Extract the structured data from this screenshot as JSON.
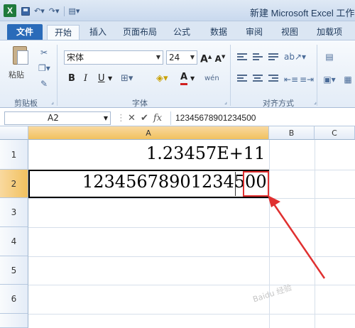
{
  "window": {
    "title": "新建 Microsoft Excel 工作表",
    "app_icon": "X"
  },
  "ribbon_tabs": [
    {
      "label": "文件"
    },
    {
      "label": "开始"
    },
    {
      "label": "插入"
    },
    {
      "label": "页面布局"
    },
    {
      "label": "公式"
    },
    {
      "label": "数据"
    },
    {
      "label": "审阅"
    },
    {
      "label": "视图"
    },
    {
      "label": "加载项"
    }
  ],
  "clipboard": {
    "paste_label": "粘贴",
    "group_label": "剪贴板"
  },
  "font": {
    "name": "宋体",
    "size": "24",
    "grow_glyph": "A",
    "shrink_glyph": "A",
    "bold": "B",
    "italic": "I",
    "underline": "U",
    "font_color_glyph": "A",
    "wen_glyph": "wén",
    "group_label": "字体"
  },
  "alignment": {
    "group_label": "对齐方式"
  },
  "formula_bar": {
    "name_box": "A2",
    "fx": "fx",
    "value": "12345678901234500"
  },
  "columns": [
    "A",
    "B",
    "C"
  ],
  "rows": [
    "1",
    "2",
    "3",
    "4",
    "5",
    "6"
  ],
  "cells": {
    "A1": "1.23457E+11",
    "A2": "12345678901234500"
  },
  "watermark": "Baidu 经验",
  "colors": {
    "accent_blue": "#2a6bb9",
    "selected_header": "#f1c15f",
    "highlight_red": "#e03030"
  }
}
